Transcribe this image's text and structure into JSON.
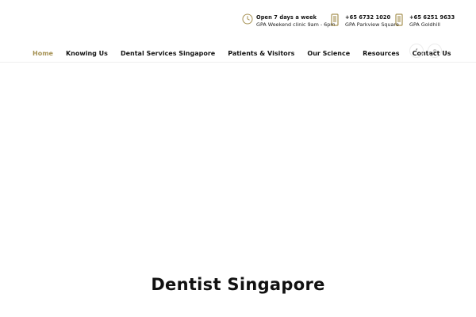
{
  "header": {
    "hours": {
      "title": "Open 7 days a week",
      "subtitle": "GPA Weekend clinic 9am - 6pm",
      "icon": "clock-icon"
    },
    "contacts": [
      {
        "phone": "+65 6732 1020",
        "location": "GPA Parkview Square",
        "icon": "phone-icon"
      },
      {
        "phone": "+65 6251 9633",
        "location": "GPA Goldhill",
        "icon": "phone-icon"
      }
    ],
    "accent_color": "#a69254"
  },
  "nav": {
    "items": [
      {
        "label": "Home",
        "active": true
      },
      {
        "label": "Knowing Us",
        "active": false
      },
      {
        "label": "Dental Services Singapore",
        "active": false
      },
      {
        "label": "Patients & Visitors",
        "active": false
      },
      {
        "label": "Our Science",
        "active": false
      },
      {
        "label": "Resources",
        "active": false
      },
      {
        "label": "Contact Us",
        "active": false
      }
    ],
    "social": {
      "facebook": "f",
      "instagram": "◎"
    }
  },
  "hero": {
    "title": "Dentist Singapore"
  }
}
